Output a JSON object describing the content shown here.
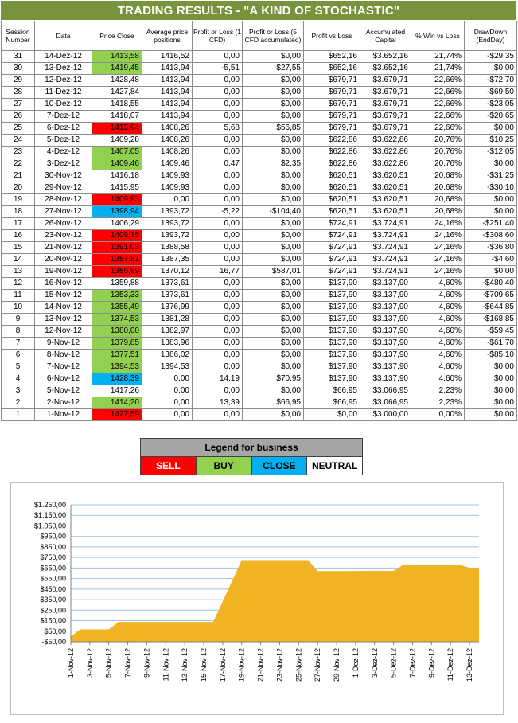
{
  "title": "TRADING RESULTS - \"A KIND OF STOCHASTIC\"",
  "table": {
    "headers": [
      "Session Number",
      "Data",
      "Price Close",
      "Average price positions",
      "Profit or Loss (1 CFD)",
      "Profit or Loss (5 CFD accumulated)",
      "Profit vs Loss",
      "Accumulated Capital",
      "% Win vs Loss",
      "DrawDown (EndDay)"
    ],
    "rows": [
      {
        "session": "31",
        "date": "14-Dez-12",
        "price": "1413,58",
        "signal": "buy",
        "avg": "1416,52",
        "pl1": "0,00",
        "pl5": "$0,00",
        "pvl": "$652,16",
        "capital": "$3.652,16",
        "win": "21,74%",
        "dd": "-$29,35"
      },
      {
        "session": "30",
        "date": "13-Dez-12",
        "price": "1419,45",
        "signal": "buy",
        "avg": "1413,94",
        "pl1": "-5,51",
        "pl5": "-$27,55",
        "pvl": "$652,16",
        "capital": "$3.652,16",
        "win": "21,74%",
        "dd": "$0,00"
      },
      {
        "session": "29",
        "date": "12-Dez-12",
        "price": "1428,48",
        "signal": "neutral",
        "avg": "1413,94",
        "pl1": "0,00",
        "pl5": "$0,00",
        "pvl": "$679,71",
        "capital": "$3.679,71",
        "win": "22,66%",
        "dd": "-$72,70"
      },
      {
        "session": "28",
        "date": "11-Dez-12",
        "price": "1427,84",
        "signal": "neutral",
        "avg": "1413,94",
        "pl1": "0,00",
        "pl5": "$0,00",
        "pvl": "$679,71",
        "capital": "$3.679,71",
        "win": "22,66%",
        "dd": "-$69,50"
      },
      {
        "session": "27",
        "date": "10-Dez-12",
        "price": "1418,55",
        "signal": "neutral",
        "avg": "1413,94",
        "pl1": "0,00",
        "pl5": "$0,00",
        "pvl": "$679,71",
        "capital": "$3.679,71",
        "win": "22,66%",
        "dd": "-$23,05"
      },
      {
        "session": "26",
        "date": "7-Dez-12",
        "price": "1418,07",
        "signal": "neutral",
        "avg": "1413,94",
        "pl1": "0,00",
        "pl5": "$0,00",
        "pvl": "$679,71",
        "capital": "$3.679,71",
        "win": "22,66%",
        "dd": "-$20,65"
      },
      {
        "session": "25",
        "date": "6-Dez-12",
        "price": "1413,94",
        "signal": "sell",
        "avg": "1408,26",
        "pl1": "5,68",
        "pl5": "$56,85",
        "pvl": "$679,71",
        "capital": "$3.679,71",
        "win": "22,66%",
        "dd": "$0,00"
      },
      {
        "session": "24",
        "date": "5-Dez-12",
        "price": "1409,28",
        "signal": "neutral",
        "avg": "1408,26",
        "pl1": "0,00",
        "pl5": "$0,00",
        "pvl": "$622,86",
        "capital": "$3.622,86",
        "win": "20,76%",
        "dd": "$10,25"
      },
      {
        "session": "23",
        "date": "4-Dez-12",
        "price": "1407,05",
        "signal": "buy",
        "avg": "1408,26",
        "pl1": "0,00",
        "pl5": "$0,00",
        "pvl": "$622,86",
        "capital": "$3.622,86",
        "win": "20,76%",
        "dd": "-$12,05"
      },
      {
        "session": "22",
        "date": "3-Dez-12",
        "price": "1409,46",
        "signal": "buy",
        "avg": "1409,46",
        "pl1": "0,47",
        "pl5": "$2,35",
        "pvl": "$622,86",
        "capital": "$3.622,86",
        "win": "20,76%",
        "dd": "$0,00"
      },
      {
        "session": "21",
        "date": "30-Nov-12",
        "price": "1416,18",
        "signal": "neutral",
        "avg": "1409,93",
        "pl1": "0,00",
        "pl5": "$0,00",
        "pvl": "$620,51",
        "capital": "$3.620,51",
        "win": "20,68%",
        "dd": "-$31,25"
      },
      {
        "session": "20",
        "date": "29-Nov-12",
        "price": "1415,95",
        "signal": "neutral",
        "avg": "1409,93",
        "pl1": "0,00",
        "pl5": "$0,00",
        "pvl": "$620,51",
        "capital": "$3.620,51",
        "win": "20,68%",
        "dd": "-$30,10"
      },
      {
        "session": "19",
        "date": "28-Nov-12",
        "price": "1409,93",
        "signal": "sell",
        "avg": "0,00",
        "pl1": "0,00",
        "pl5": "$0,00",
        "pvl": "$620,51",
        "capital": "$3.620,51",
        "win": "20,68%",
        "dd": "$0,00"
      },
      {
        "session": "18",
        "date": "27-Nov-12",
        "price": "1398,94",
        "signal": "close",
        "avg": "1393,72",
        "pl1": "-5,22",
        "pl5": "-$104,40",
        "pvl": "$620,51",
        "capital": "$3.620,51",
        "win": "20,68%",
        "dd": "$0,00"
      },
      {
        "session": "17",
        "date": "26-Nov-12",
        "price": "1406,29",
        "signal": "neutral",
        "avg": "1393,72",
        "pl1": "0,00",
        "pl5": "$0,00",
        "pvl": "$724,91",
        "capital": "$3.724,91",
        "win": "24,16%",
        "dd": "-$251,40"
      },
      {
        "session": "16",
        "date": "23-Nov-12",
        "price": "1409,15",
        "signal": "sell",
        "avg": "1393,72",
        "pl1": "0,00",
        "pl5": "$0,00",
        "pvl": "$724,91",
        "capital": "$3.724,91",
        "win": "24,16%",
        "dd": "-$308,60"
      },
      {
        "session": "15",
        "date": "21-Nov-12",
        "price": "1391,03",
        "signal": "sell",
        "avg": "1388,58",
        "pl1": "0,00",
        "pl5": "$0,00",
        "pvl": "$724,91",
        "capital": "$3.724,91",
        "win": "24,16%",
        "dd": "-$36,80"
      },
      {
        "session": "14",
        "date": "20-Nov-12",
        "price": "1387,81",
        "signal": "sell",
        "avg": "1387,35",
        "pl1": "0,00",
        "pl5": "$0,00",
        "pvl": "$724,91",
        "capital": "$3.724,91",
        "win": "24,16%",
        "dd": "-$4,60"
      },
      {
        "session": "13",
        "date": "19-Nov-12",
        "price": "1386,89",
        "signal": "sell",
        "avg": "1370,12",
        "pl1": "16,77",
        "pl5": "$587,01",
        "pvl": "$724,91",
        "capital": "$3.724,91",
        "win": "24,16%",
        "dd": "$0,00"
      },
      {
        "session": "12",
        "date": "16-Nov-12",
        "price": "1359,88",
        "signal": "neutral",
        "avg": "1373,61",
        "pl1": "0,00",
        "pl5": "$0,00",
        "pvl": "$137,90",
        "capital": "$3.137,90",
        "win": "4,60%",
        "dd": "-$480,40"
      },
      {
        "session": "11",
        "date": "15-Nov-12",
        "price": "1353,33",
        "signal": "buy",
        "avg": "1373,61",
        "pl1": "0,00",
        "pl5": "$0,00",
        "pvl": "$137,90",
        "capital": "$3.137,90",
        "win": "4,60%",
        "dd": "-$709,65"
      },
      {
        "session": "10",
        "date": "14-Nov-12",
        "price": "1355,49",
        "signal": "buy",
        "avg": "1376,99",
        "pl1": "0,00",
        "pl5": "$0,00",
        "pvl": "$137,90",
        "capital": "$3.137,90",
        "win": "4,60%",
        "dd": "-$644,85"
      },
      {
        "session": "9",
        "date": "13-Nov-12",
        "price": "1374,53",
        "signal": "buy",
        "avg": "1381,28",
        "pl1": "0,00",
        "pl5": "$0,00",
        "pvl": "$137,90",
        "capital": "$3.137,90",
        "win": "4,60%",
        "dd": "-$168,85"
      },
      {
        "session": "8",
        "date": "12-Nov-12",
        "price": "1380,00",
        "signal": "buy",
        "avg": "1382,97",
        "pl1": "0,00",
        "pl5": "$0,00",
        "pvl": "$137,90",
        "capital": "$3.137,90",
        "win": "4,60%",
        "dd": "-$59,45"
      },
      {
        "session": "7",
        "date": "9-Nov-12",
        "price": "1379,85",
        "signal": "buy",
        "avg": "1383,96",
        "pl1": "0,00",
        "pl5": "$0,00",
        "pvl": "$137,90",
        "capital": "$3.137,90",
        "win": "4,60%",
        "dd": "-$61,70"
      },
      {
        "session": "6",
        "date": "8-Nov-12",
        "price": "1377,51",
        "signal": "buy",
        "avg": "1386,02",
        "pl1": "0,00",
        "pl5": "$0,00",
        "pvl": "$137,90",
        "capital": "$3.137,90",
        "win": "4,60%",
        "dd": "-$85,10"
      },
      {
        "session": "5",
        "date": "7-Nov-12",
        "price": "1394,53",
        "signal": "buy",
        "avg": "1394,53",
        "pl1": "0,00",
        "pl5": "$0,00",
        "pvl": "$137,90",
        "capital": "$3.137,90",
        "win": "4,60%",
        "dd": "$0,00"
      },
      {
        "session": "4",
        "date": "6-Nov-12",
        "price": "1428,39",
        "signal": "close",
        "avg": "0,00",
        "pl1": "14,19",
        "pl5": "$70,95",
        "pvl": "$137,90",
        "capital": "$3.137,90",
        "win": "4,60%",
        "dd": "$0,00"
      },
      {
        "session": "3",
        "date": "5-Nov-12",
        "price": "1417,26",
        "signal": "neutral",
        "avg": "0,00",
        "pl1": "0,00",
        "pl5": "$0,00",
        "pvl": "$66,95",
        "capital": "$3.066,95",
        "win": "2,23%",
        "dd": "$0,00"
      },
      {
        "session": "2",
        "date": "2-Nov-12",
        "price": "1414,20",
        "signal": "buy",
        "avg": "0,00",
        "pl1": "13,39",
        "pl5": "$66,95",
        "pvl": "$66,95",
        "capital": "$3.066,95",
        "win": "2,23%",
        "dd": "$0,00"
      },
      {
        "session": "1",
        "date": "1-Nov-12",
        "price": "1427,59",
        "signal": "sell",
        "avg": "0,00",
        "pl1": "0,00",
        "pl5": "$0,00",
        "pvl": "$0,00",
        "capital": "$3.000,00",
        "win": "0,00%",
        "dd": "$0,00"
      }
    ]
  },
  "legend": {
    "title": "Legend for business",
    "items": [
      {
        "key": "sell",
        "label": "SELL"
      },
      {
        "key": "buy",
        "label": "BUY"
      },
      {
        "key": "close",
        "label": "CLOSE"
      },
      {
        "key": "neutral",
        "label": "NEUTRAL"
      }
    ]
  },
  "colors": {
    "title_bg": "#77933c",
    "sell": "#ff0000",
    "buy": "#92d050",
    "close": "#00b0f0",
    "area_fill": "#f0b323",
    "grid": "#9ec3e6"
  },
  "chart_data": {
    "type": "area",
    "title": "",
    "xlabel": "",
    "ylabel": "",
    "ylim": [
      -50,
      1250
    ],
    "ytick_step": 100,
    "y_ticks": [
      "-$50,00",
      "$50,00",
      "$150,00",
      "$250,00",
      "$350,00",
      "$450,00",
      "$550,00",
      "$650,00",
      "$750,00",
      "$850,00",
      "$950,00",
      "$1.050,00",
      "$1.150,00",
      "$1.250,00"
    ],
    "x_tick_labels": [
      "1-Nov-12",
      "3-Nov-12",
      "5-Nov-12",
      "7-Nov-12",
      "9-Nov-12",
      "11-Nov-12",
      "13-Nov-12",
      "15-Nov-12",
      "17-Nov-12",
      "19-Nov-12",
      "21-Nov-12",
      "23-Nov-12",
      "25-Nov-12",
      "27-Nov-12",
      "29-Nov-12",
      "1-Dez-12",
      "3-Dez-12",
      "5-Dez-12",
      "7-Dez-12",
      "9-Dez-12",
      "11-Dez-12",
      "13-Dez-12"
    ],
    "x_range": [
      "2012-11-01",
      "2012-12-14"
    ],
    "grid": true,
    "series": [
      {
        "x": [
          "2012-11-01",
          "2012-11-02",
          "2012-11-05",
          "2012-11-06",
          "2012-11-07",
          "2012-11-08",
          "2012-11-09",
          "2012-11-12",
          "2012-11-13",
          "2012-11-14",
          "2012-11-15",
          "2012-11-16",
          "2012-11-19",
          "2012-11-20",
          "2012-11-21",
          "2012-11-23",
          "2012-11-26",
          "2012-11-27",
          "2012-11-28",
          "2012-11-29",
          "2012-11-30",
          "2012-12-03",
          "2012-12-04",
          "2012-12-05",
          "2012-12-06",
          "2012-12-07",
          "2012-12-10",
          "2012-12-11",
          "2012-12-12",
          "2012-12-13",
          "2012-12-14"
        ],
        "values": [
          0,
          66.95,
          66.95,
          137.9,
          137.9,
          137.9,
          137.9,
          137.9,
          137.9,
          137.9,
          137.9,
          137.9,
          724.91,
          724.91,
          724.91,
          724.91,
          724.91,
          620.51,
          620.51,
          620.51,
          620.51,
          622.86,
          622.86,
          622.86,
          679.71,
          679.71,
          679.71,
          679.71,
          679.71,
          652.16,
          652.16
        ]
      }
    ]
  }
}
